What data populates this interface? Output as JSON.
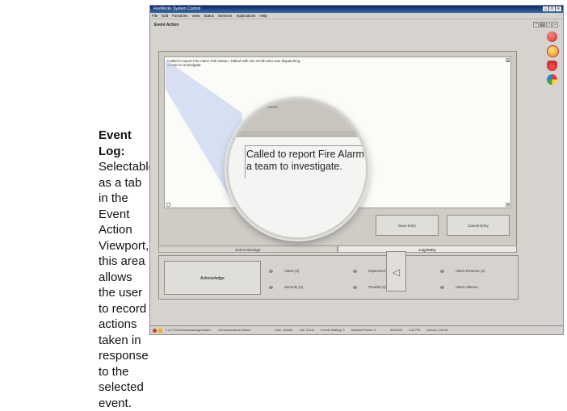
{
  "caption": {
    "title": "Event Log:",
    "body": "Selectable as a tab in the Event Action Viewport, this area allows the user to record actions taken in response to the selected event."
  },
  "window": {
    "title": "FireWorks System Control",
    "menu": [
      "File",
      "Edit",
      "Functions",
      "View",
      "Status",
      "Services",
      "Applications",
      "Help"
    ],
    "heading": "Event Action"
  },
  "log": {
    "text_line1": "Called to report Fire Alarm Pull station.  Talked with Jim Smith who was dispatching",
    "text_line2": "a team to investigate."
  },
  "magnifier": {
    "tiny": "EVENT",
    "line1": "Called to report Fire Alarm P",
    "line2": "a team to investigate."
  },
  "buttons": {
    "save": "Save Entry",
    "cancel": "Cancel Entry"
  },
  "tabs": [
    "Event Message",
    "Log Entry"
  ],
  "acknowledge": "Acknowledge",
  "events": [
    "Alarm (2)",
    "Supervisory (1)",
    "Alarm Reverse (2)",
    "Security (4)",
    "Trouble (4)",
    "Alarm Silence"
  ],
  "statusbar": {
    "cells": [
      "1 of 1 Event Acknowledged Alarm",
      "Communications Failure",
      "User: ADMIN",
      "Job: 30112",
      "Events Waiting: 4",
      "Disabled Points: 8",
      "5/6/2003",
      "1:32 PM",
      "Version 2.00.04"
    ]
  },
  "colors": {
    "titlebar": "#0a246a",
    "window_bg": "#d6d3ce",
    "alarm_red": "#d9302a",
    "warn_yellow": "#f0b020"
  }
}
